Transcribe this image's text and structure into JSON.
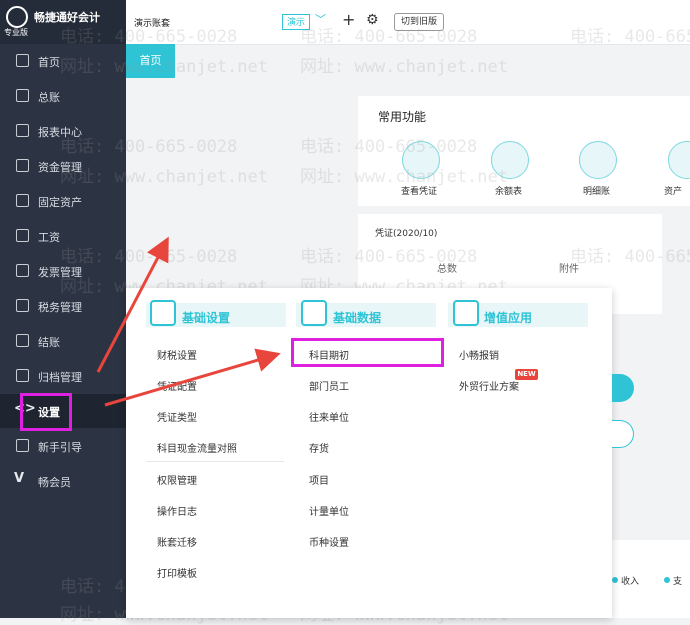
{
  "app": {
    "brand": "畅捷通好会计",
    "edition": "专业版"
  },
  "sidebar": {
    "items": [
      {
        "label": "首页",
        "icon": "home-icon"
      },
      {
        "label": "总账",
        "icon": "ledger-icon"
      },
      {
        "label": "报表中心",
        "icon": "chart-icon"
      },
      {
        "label": "资金管理",
        "icon": "money-bag-icon"
      },
      {
        "label": "固定资产",
        "icon": "building-icon"
      },
      {
        "label": "工资",
        "icon": "salary-icon"
      },
      {
        "label": "发票管理",
        "icon": "invoice-icon"
      },
      {
        "label": "税务管理",
        "icon": "tax-icon"
      },
      {
        "label": "结账",
        "icon": "checkout-icon"
      },
      {
        "label": "归档管理",
        "icon": "archive-icon"
      },
      {
        "label": "设置",
        "icon": "settings-icon"
      },
      {
        "label": "新手引导",
        "icon": "play-icon"
      },
      {
        "label": "畅会员",
        "icon": "vip-icon"
      }
    ],
    "vip_glyph": "V",
    "settings_glyph": "<>"
  },
  "topbar": {
    "ledger_label": "演示账套",
    "period_value": "演示",
    "chevron": "﹀",
    "plus": "+",
    "gear": "⚙",
    "switch_old": "切到旧版"
  },
  "tabs": {
    "home": "首页"
  },
  "functions": {
    "title": "常用功能",
    "items": [
      {
        "label": "查看凭证",
        "icon": "voucher-search-icon"
      },
      {
        "label": "余额表",
        "icon": "balance-icon"
      },
      {
        "label": "明细账",
        "icon": "detail-ledger-icon"
      },
      {
        "label": "资产",
        "icon": "asset-icon"
      }
    ]
  },
  "voucher": {
    "title": "凭证(2020/10)",
    "col_total": "总数",
    "col_attach": "附件"
  },
  "legend": {
    "income": "收入",
    "expense": "支"
  },
  "watermark": {
    "phone": "电话: 400-665-0028",
    "site": "网址: www.chanjet.net"
  },
  "menu": {
    "basic_settings": {
      "title": "基础设置",
      "items": [
        "财税设置",
        "凭证配置",
        "凭证类型",
        "科目现金流量对照",
        "权限管理",
        "操作日志",
        "账套迁移",
        "打印模板"
      ]
    },
    "basic_data": {
      "title": "基础数据",
      "items": [
        "科目期初",
        "部门员工",
        "往来单位",
        "存货",
        "项目",
        "计量单位",
        "币种设置"
      ]
    },
    "value_added": {
      "title": "增值应用",
      "items": [
        "小畅报销",
        "外贸行业方案"
      ],
      "badge": "NEW"
    }
  },
  "colors": {
    "accent": "#2ec4d6",
    "sidebar": "#2c3443",
    "highlight": "#e020e0",
    "arrow": "#e8453c",
    "badge": "#e8453c"
  }
}
